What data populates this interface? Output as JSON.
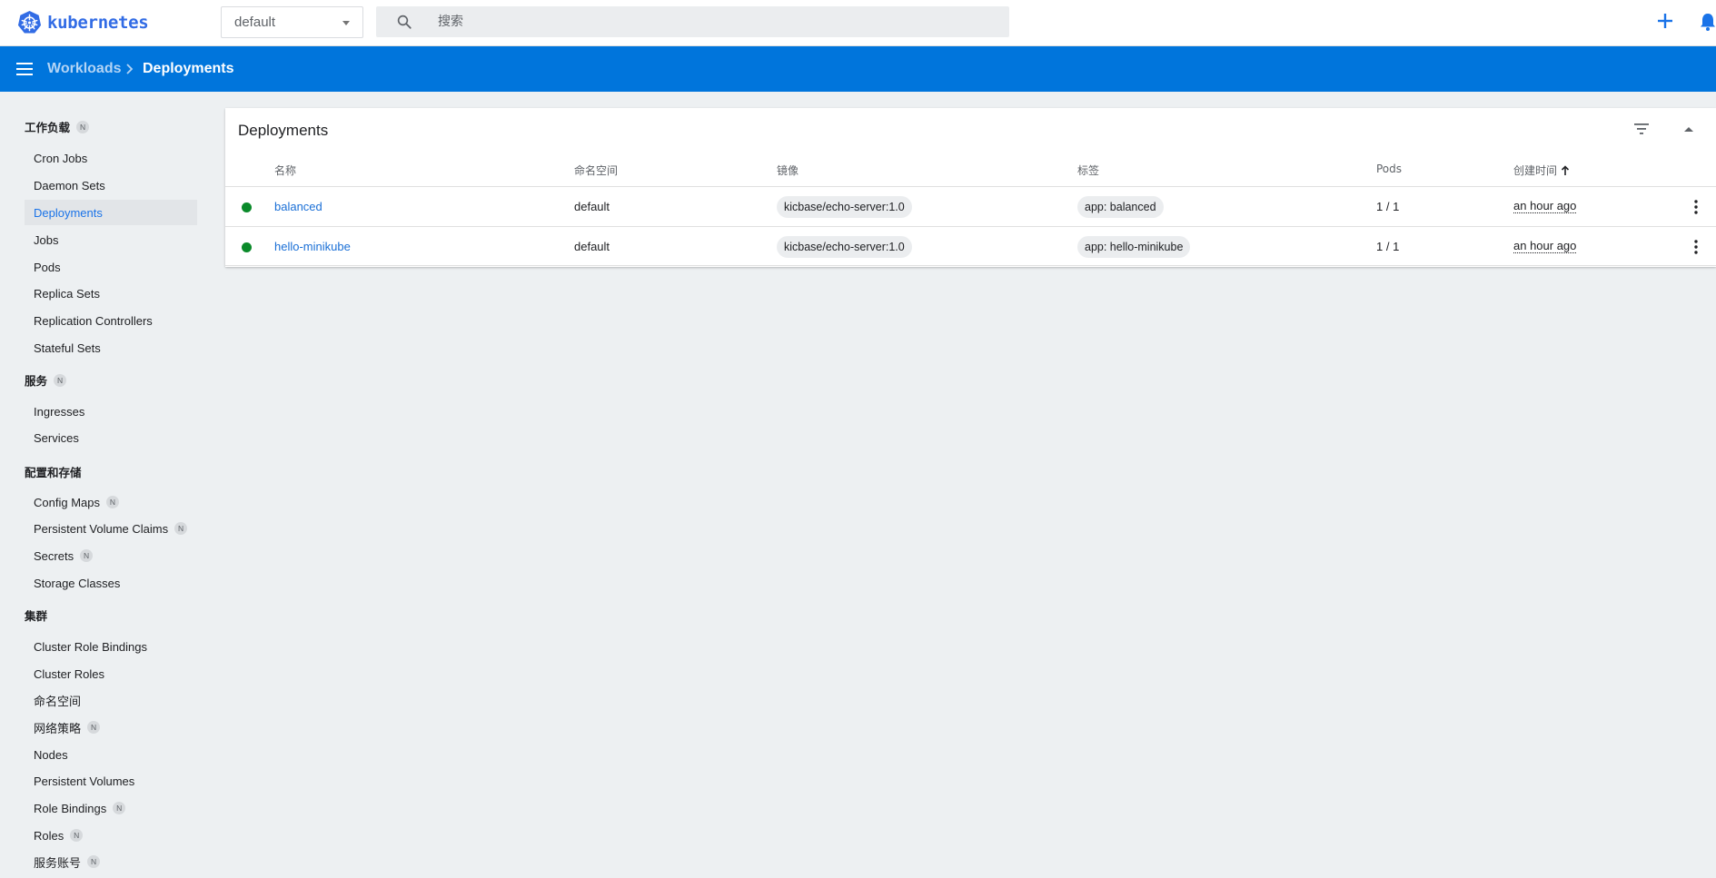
{
  "app": {
    "logo_text": "kubernetes"
  },
  "topbar": {
    "namespace": "default",
    "search_placeholder": "搜索"
  },
  "breadcrumb": {
    "parent": "Workloads",
    "current": "Deployments"
  },
  "sidebar": {
    "sections": [
      {
        "heading": "工作负载",
        "badge": "N",
        "items": [
          {
            "label": "Cron Jobs"
          },
          {
            "label": "Daemon Sets"
          },
          {
            "label": "Deployments",
            "active": true
          },
          {
            "label": "Jobs"
          },
          {
            "label": "Pods"
          },
          {
            "label": "Replica Sets"
          },
          {
            "label": "Replication Controllers"
          },
          {
            "label": "Stateful Sets"
          }
        ]
      },
      {
        "heading": "服务",
        "badge": "N",
        "items": [
          {
            "label": "Ingresses"
          },
          {
            "label": "Services"
          }
        ]
      },
      {
        "heading": "配置和存储",
        "items": [
          {
            "label": "Config Maps",
            "badge": "N"
          },
          {
            "label": "Persistent Volume Claims",
            "badge": "N"
          },
          {
            "label": "Secrets",
            "badge": "N"
          },
          {
            "label": "Storage Classes"
          }
        ]
      },
      {
        "heading": "集群",
        "items": [
          {
            "label": "Cluster Role Bindings"
          },
          {
            "label": "Cluster Roles"
          },
          {
            "label": "命名空间"
          },
          {
            "label": "网络策略",
            "badge": "N"
          },
          {
            "label": "Nodes"
          },
          {
            "label": "Persistent Volumes"
          },
          {
            "label": "Role Bindings",
            "badge": "N"
          },
          {
            "label": "Roles",
            "badge": "N"
          },
          {
            "label": "服务账号",
            "badge": "N"
          }
        ]
      }
    ]
  },
  "card": {
    "title": "Deployments",
    "columns": [
      "名称",
      "命名空间",
      "镜像",
      "标签",
      "Pods",
      "创建时间"
    ],
    "rows": [
      {
        "status": "running",
        "name": "balanced",
        "namespace": "default",
        "image": "kicbase/echo-server:1.0",
        "label": "app: balanced",
        "pods": "1 / 1",
        "created": "an hour ago"
      },
      {
        "status": "running",
        "name": "hello-minikube",
        "namespace": "default",
        "image": "kicbase/echo-server:1.0",
        "label": "app: hello-minikube",
        "pods": "1 / 1",
        "created": "an hour ago"
      }
    ]
  },
  "colors": {
    "brand": "#326ce5",
    "header": "#0075dc",
    "status_ok": "#0a8a2a",
    "link": "#1a6fd6"
  },
  "icons": [
    "kubernetes-logo-icon",
    "dropdown-arrow-icon",
    "search-icon",
    "plus-icon",
    "bell-icon",
    "menu-icon",
    "chevron-right-icon",
    "filter-icon",
    "collapse-icon",
    "sort-arrow-icon",
    "more-vert-icon"
  ]
}
